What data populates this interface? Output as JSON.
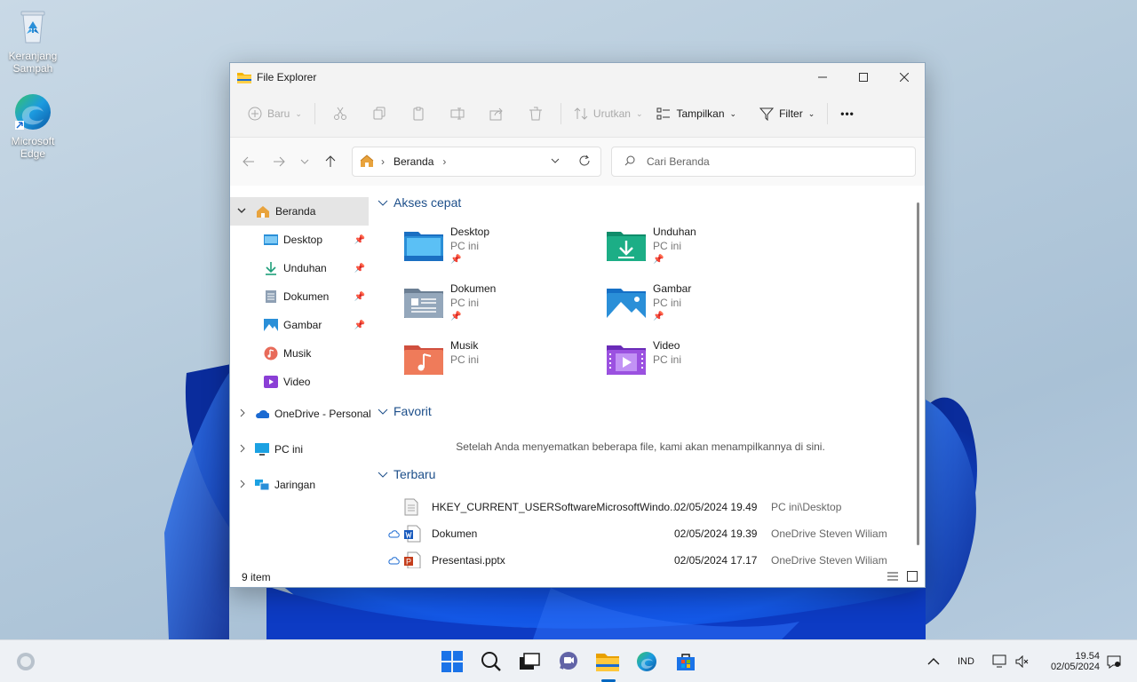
{
  "desktop": {
    "icons": [
      {
        "label": "Keranjang Sampah",
        "icon": "recycle-bin-icon"
      },
      {
        "label": "Microsoft Edge",
        "icon": "edge-icon"
      }
    ]
  },
  "window": {
    "title": "File Explorer",
    "ribbon": {
      "new_label": "Baru",
      "sort_label": "Urutkan",
      "view_label": "Tampilkan",
      "filter_label": "Filter",
      "more_label": "•••"
    },
    "address": {
      "location": "Beranda",
      "separator": "›"
    },
    "search_placeholder": "Cari Beranda",
    "sidebar": {
      "home": "Beranda",
      "items": [
        {
          "label": "Desktop",
          "pinned": true
        },
        {
          "label": "Unduhan",
          "pinned": true
        },
        {
          "label": "Dokumen",
          "pinned": true
        },
        {
          "label": "Gambar",
          "pinned": true
        },
        {
          "label": "Musik",
          "pinned": false
        },
        {
          "label": "Video",
          "pinned": false
        }
      ],
      "groups": [
        "OneDrive - Personal",
        "PC ini",
        "Jaringan"
      ]
    },
    "quick_access": {
      "heading": "Akses cepat",
      "tiles": [
        {
          "name": "Desktop",
          "location": "PC ini"
        },
        {
          "name": "Unduhan",
          "location": "PC ini"
        },
        {
          "name": "Dokumen",
          "location": "PC ini"
        },
        {
          "name": "Gambar",
          "location": "PC ini"
        },
        {
          "name": "Musik",
          "location": "PC ini"
        },
        {
          "name": "Video",
          "location": "PC ini"
        }
      ]
    },
    "favorites": {
      "heading": "Favorit",
      "empty_text": "Setelah Anda menyematkan beberapa file, kami akan menampilkannya di sini."
    },
    "recent": {
      "heading": "Terbaru",
      "rows": [
        {
          "name": "HKEY_CURRENT_USERSoftwareMicrosoftWindo...",
          "date": "02/05/2024 19.49",
          "location": "PC ini\\Desktop"
        },
        {
          "name": "Dokumen",
          "date": "02/05/2024 19.39",
          "location": "OneDrive Steven Wiliam"
        },
        {
          "name": "Presentasi.pptx",
          "date": "02/05/2024 17.17",
          "location": "OneDrive Steven Wiliam"
        }
      ]
    },
    "status": "9 item"
  },
  "taskbar": {
    "lang": "IND",
    "time": "19.54",
    "date": "02/05/2024"
  },
  "colors": {
    "accent": "#0067c0",
    "heading": "#1d4f8a"
  }
}
